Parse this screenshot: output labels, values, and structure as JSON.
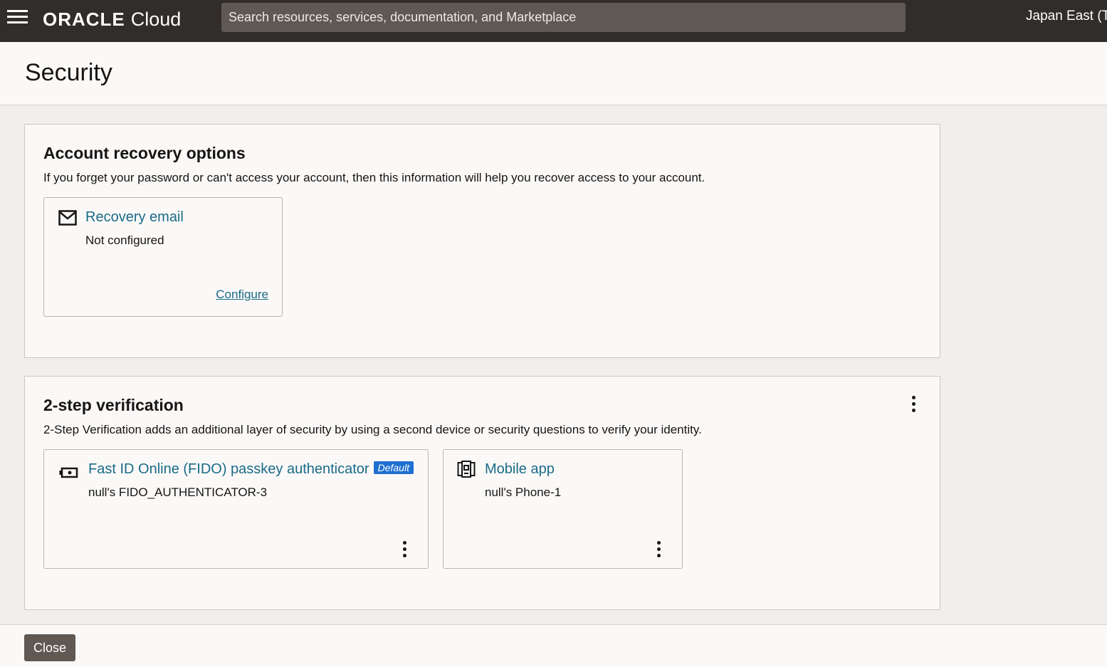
{
  "topbar": {
    "brand_main": "ORACLE",
    "brand_sub": "Cloud",
    "search_placeholder": "Search resources, services, documentation, and Marketplace",
    "region": "Japan East (T"
  },
  "page": {
    "title": "Security"
  },
  "recovery": {
    "title": "Account recovery options",
    "description": "If you forget your password or can't access your account, then this information will help you recover access to your account.",
    "email_tile": {
      "title": "Recovery email",
      "status": "Not configured",
      "action": "Configure",
      "icon": "mail-icon"
    }
  },
  "two_step": {
    "title": "2-step verification",
    "description": "2-Step Verification adds an additional layer of security by using a second device or security questions to verify your identity.",
    "tiles": [
      {
        "title": "Fast ID Online (FIDO) passkey authenticator",
        "badge": "Default",
        "subtitle": "null's FIDO_AUTHENTICATOR-3",
        "icon": "security-key-icon"
      },
      {
        "title": "Mobile app",
        "subtitle": "null's Phone-1",
        "icon": "mobile-app-icon"
      }
    ]
  },
  "footer": {
    "close_label": "Close"
  },
  "colors": {
    "topbar": "#312d2a",
    "link": "#1a6a87",
    "badge": "#1e6fd1",
    "button": "#5f5853"
  }
}
